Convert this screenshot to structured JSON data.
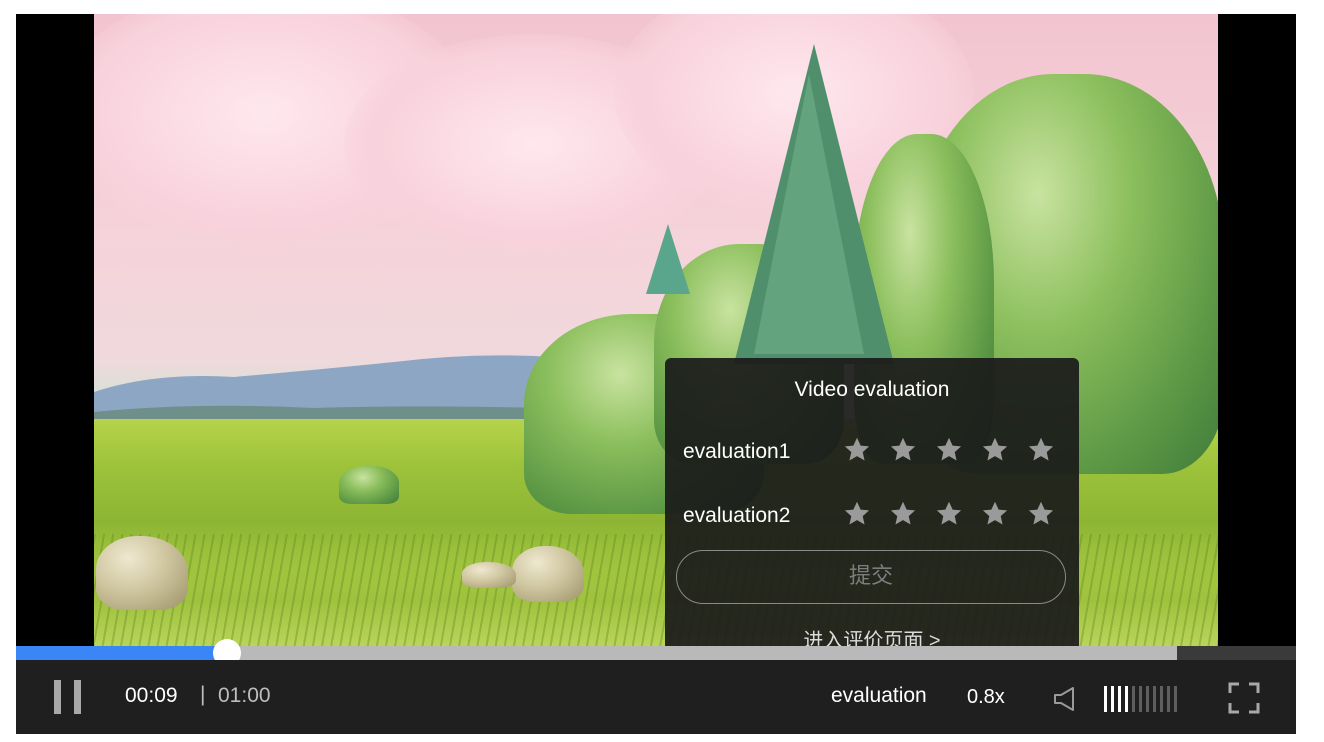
{
  "popup": {
    "title": "Video evaluation",
    "rows": [
      {
        "label": "evaluation1",
        "stars": 5
      },
      {
        "label": "evaluation2",
        "stars": 5
      }
    ],
    "submit_label": "提交",
    "link_label": "进入评价页面 >"
  },
  "player": {
    "current_time": "00:09",
    "separator": "|",
    "total_time": "01:00",
    "progress_fraction": 0.165,
    "buffered_fraction": 0.907,
    "evaluation_label": "evaluation",
    "speed_label": "0.8x",
    "volume_level": 4,
    "volume_max": 11
  },
  "colors": {
    "progress_played": "#3a86f7",
    "progress_buffer": "#b9b9b9",
    "control_bar": "#1f1f1f",
    "star": "#9a9a9a"
  },
  "icons": {
    "pause": "pause-icon",
    "volume": "speaker-icon",
    "fullscreen": "fullscreen-icon",
    "star": "star-icon"
  }
}
